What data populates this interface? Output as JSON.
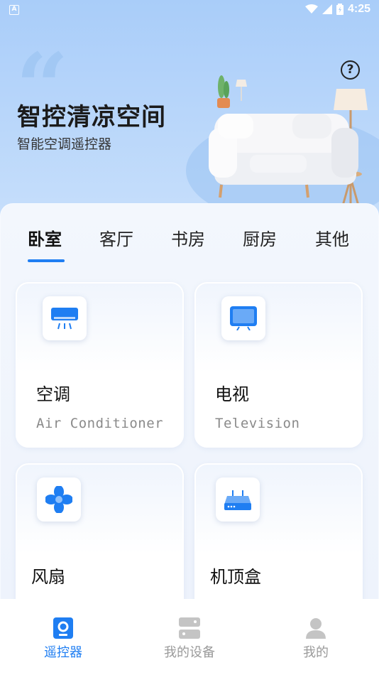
{
  "status_bar": {
    "time": "4:25",
    "left_badge": "A"
  },
  "header": {
    "title": "智控清凉空间",
    "subtitle": "智能空调遥控器",
    "help_label": "?"
  },
  "tabs": [
    "卧室",
    "客厅",
    "书房",
    "厨房",
    "其他"
  ],
  "active_tab": "卧室",
  "devices": [
    {
      "title": "空调",
      "subtitle": "Air Conditioner",
      "icon": "air-conditioner-icon"
    },
    {
      "title": "电视",
      "subtitle": "Television",
      "icon": "television-icon"
    },
    {
      "title": "风扇",
      "subtitle": "",
      "icon": "fan-icon"
    },
    {
      "title": "机顶盒",
      "subtitle": "",
      "icon": "set-top-box-icon"
    }
  ],
  "bottom_nav": [
    {
      "label": "遥控器",
      "icon": "remote-icon",
      "active": true
    },
    {
      "label": "我的设备",
      "icon": "devices-icon",
      "active": false
    },
    {
      "label": "我的",
      "icon": "profile-icon",
      "active": false
    }
  ],
  "colors": {
    "accent": "#1f7ef2",
    "inactive_nav": "#9a9a9a"
  }
}
